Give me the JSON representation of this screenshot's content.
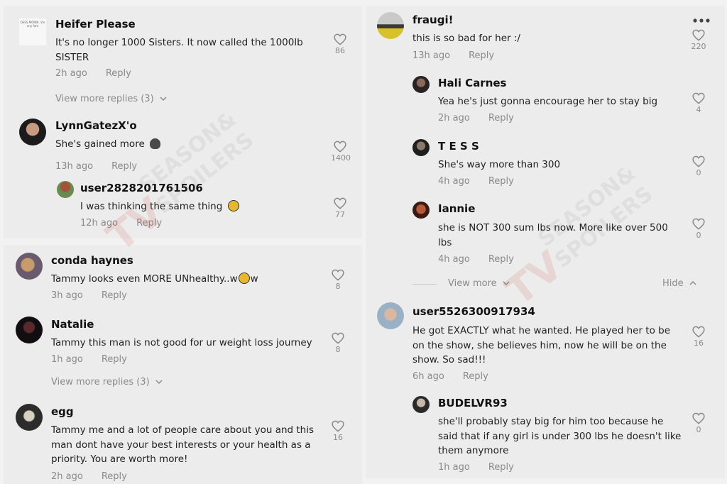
{
  "left_top": {
    "c1": {
      "name": "Heifer Please",
      "text": "It's no longer 1000 Sisters. It now called the 1000lb SISTER",
      "time": "2h ago",
      "reply": "Reply",
      "likes": "86",
      "view_more": "View more replies (3)"
    },
    "c2": {
      "name": "LynnGatezX'o",
      "text": "She's gained more",
      "time": "13h ago",
      "reply": "Reply",
      "likes": "1400"
    },
    "c3": {
      "name": "user2828201761506",
      "text": "I was thinking the same thing",
      "time": "12h ago",
      "reply": "Reply",
      "likes": "77"
    }
  },
  "left_bottom": {
    "c1": {
      "name": "conda haynes",
      "text_a": "Tammy looks even MORE UNhealthy..w",
      "text_b": "w",
      "time": "3h ago",
      "reply": "Reply",
      "likes": "8"
    },
    "c2": {
      "name": "Natalie",
      "text": "Tammy this man is not good for ur weight loss journey",
      "time": "1h ago",
      "reply": "Reply",
      "likes": "8",
      "view_more": "View more replies (3)"
    },
    "c3": {
      "name": "egg",
      "text": "Tammy me and a lot of people care about you and this man dont have your best interests or your health as a priority. You are worth more!",
      "time": "2h ago",
      "reply": "Reply",
      "likes": "16"
    }
  },
  "right": {
    "c1": {
      "name": "fraugi!",
      "text": "this is so bad for her :/",
      "time": "13h ago",
      "reply": "Reply",
      "likes": "220"
    },
    "c2": {
      "name": "Hali Carnes",
      "text": "Yea he's just gonna encourage her to stay big",
      "time": "2h ago",
      "reply": "Reply",
      "likes": "4"
    },
    "c3": {
      "name": "T E S S",
      "text": "She's way more than 300",
      "time": "4h ago",
      "reply": "Reply",
      "likes": "0"
    },
    "c4": {
      "name": "Iannie",
      "text": "she is NOT 300 sum lbs now. More like over 500 lbs",
      "time": "4h ago",
      "reply": "Reply",
      "likes": "0"
    },
    "view_more": "View more",
    "hide": "Hide",
    "c5": {
      "name": "user5526300917934",
      "text": "He got EXACTLY what he wanted. He played her to be on the show, she believes him, now he will be on the show. So sad!!!",
      "time": "6h ago",
      "reply": "Reply",
      "likes": "16"
    },
    "c6": {
      "name": "BUDELVR93",
      "text": "she'll probably stay big for him too because he said that if any girl is under 300 lbs he doesn't like them anymore",
      "time": "1h ago",
      "reply": "Reply",
      "likes": "0"
    }
  },
  "avatar_text": "DEES MONIN. Vin any fam",
  "watermark": {
    "line1": "SEASON&",
    "line2": "SPOILERS",
    "logo": "TV"
  },
  "colors": {
    "panel": "#ececec",
    "meta": "#8a8a8a",
    "watermark": "#c0392b"
  },
  "icons": [
    "heart-outline-icon",
    "chevron-down-icon",
    "chevron-up-icon",
    "more-options-icon",
    "skull-emoji",
    "frowning-emoji"
  ]
}
